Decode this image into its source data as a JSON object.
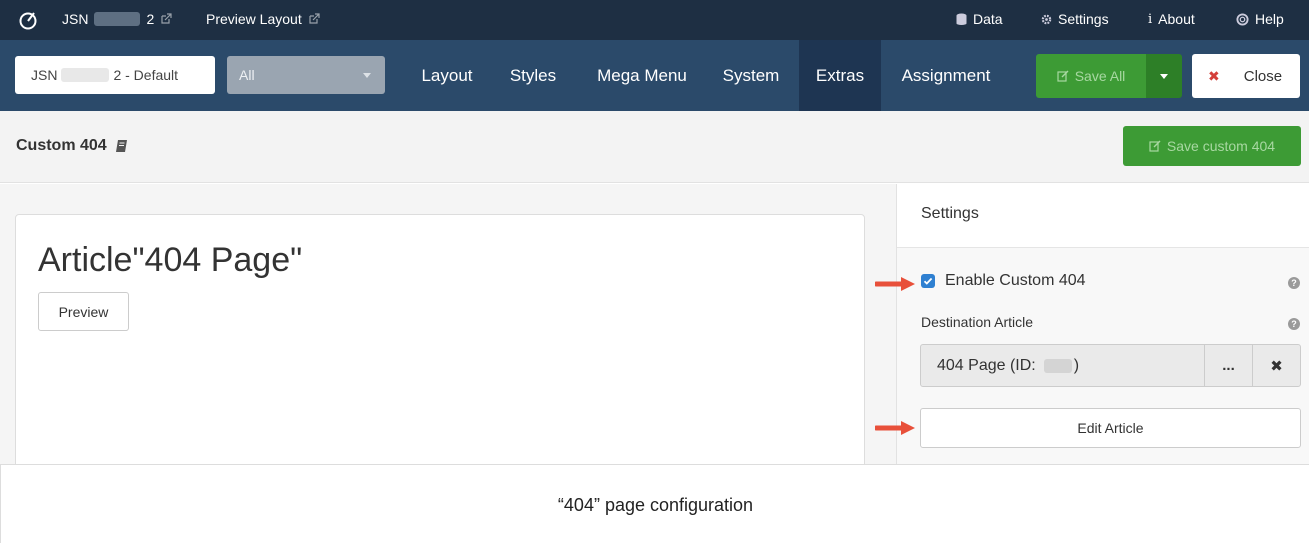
{
  "topbar": {
    "site_name_prefix": "JSN",
    "site_name_suffix": "2",
    "preview_layout": "Preview Layout",
    "data": "Data",
    "settings": "Settings",
    "about": "About",
    "help": "Help"
  },
  "navbar": {
    "template_prefix": "JSN",
    "template_suffix": "2 - Default",
    "filter_value": "All",
    "tabs": [
      "Layout",
      "Styles",
      "Mega Menu",
      "System",
      "Extras",
      "Assignment"
    ],
    "active_tab": "Extras",
    "save_all": "Save All",
    "close": "Close",
    "colors": {
      "bar": "#2b4a6a",
      "topbar": "#1e2f43",
      "save_green": "#3d9b35",
      "close_red": "#d43f3a"
    }
  },
  "subheader": {
    "title": "Custom 404",
    "save_button": "Save custom 404"
  },
  "main": {
    "heading": "Article\"404 Page\"",
    "preview_button": "Preview"
  },
  "settings": {
    "title": "Settings",
    "enable_label": "Enable Custom 404",
    "enable_checked": true,
    "destination_label": "Destination Article",
    "destination_value_prefix": "404 Page (ID:",
    "destination_value_suffix": ")",
    "select_button": "...",
    "edit_button": "Edit Article"
  },
  "caption": "“404” page configuration"
}
